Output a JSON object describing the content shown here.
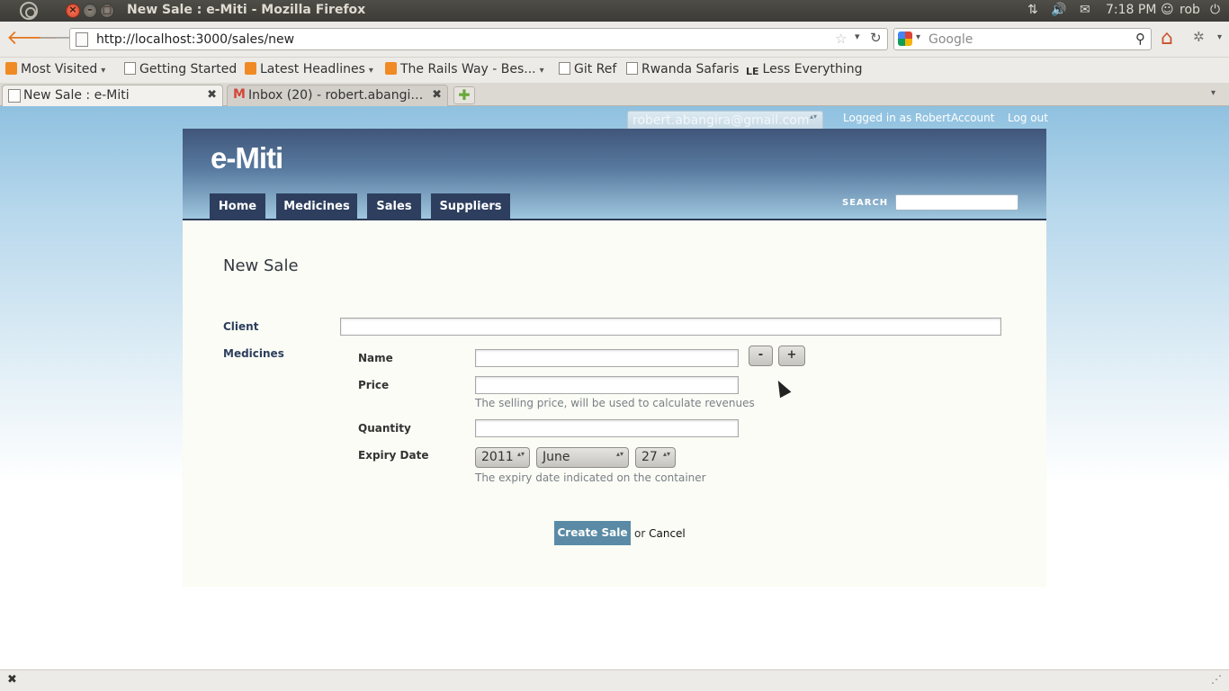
{
  "os_panel": {
    "window_title": "New Sale : e-Miti - Mozilla Firefox",
    "clock": "7:18 PM",
    "user": "rob",
    "close_glyph": "×",
    "min_glyph": "–",
    "max_glyph": "□",
    "network_icon": "⇅",
    "volume_icon": "🔊",
    "mail_icon": "✉",
    "user_icon": "☺",
    "power_icon": "⏻"
  },
  "browser": {
    "back_icon": "🡐",
    "forward_icon": "🡒",
    "url": "http://localhost:3000/sales/new",
    "star_icon": "☆",
    "dropdown_icon": "▾",
    "reload_icon": "↻",
    "search_placeholder": "Google",
    "search_icon": "⚲",
    "home_icon": "⌂",
    "addon_icon": "✲",
    "bookmarks": [
      {
        "label": "Most Visited",
        "dropdown": "▾"
      },
      {
        "label": "Getting Started"
      },
      {
        "label": "Latest Headlines",
        "dropdown": "▾"
      },
      {
        "label": "The Rails Way - Bes...",
        "dropdown": "▾"
      },
      {
        "label": "Git Ref"
      },
      {
        "label": "Rwanda Safaris"
      },
      {
        "label": "Less Everything",
        "icon_text": "LE"
      }
    ],
    "tabs": [
      {
        "label": "New Sale : e-Miti",
        "close": "✖"
      },
      {
        "label": "Inbox (20) - robert.abangira...",
        "close": "✖",
        "icon_text": "M"
      }
    ],
    "new_tab_icon": "✚",
    "tab_list_icon": "▾",
    "status_close": "✖",
    "status_grip": "⋰"
  },
  "page": {
    "account_email": "robert.abangira@gmail.com",
    "account_arrows": "▴▾",
    "logged_in": "Logged in as Robert",
    "account_link": "Account",
    "logout_link": "Log out",
    "logo": "e-Miti",
    "nav": [
      "Home",
      "Medicines",
      "Sales",
      "Suppliers"
    ],
    "search_label": "SEARCH",
    "title": "New Sale",
    "form": {
      "client_label": "Client",
      "medicines_label": "Medicines",
      "name_label": "Name",
      "remove_button": "-",
      "add_button": "+",
      "price_label": "Price",
      "price_hint": "The selling price, will be used to calculate revenues",
      "quantity_label": "Quantity",
      "expiry_label": "Expiry Date",
      "expiry_year": "2011",
      "expiry_month": "June",
      "expiry_day": "27",
      "expiry_hint": "The expiry date indicated on the container",
      "select_arrows": "▴▾",
      "submit": "Create Sale",
      "or_text": "or",
      "cancel": "Cancel"
    }
  }
}
